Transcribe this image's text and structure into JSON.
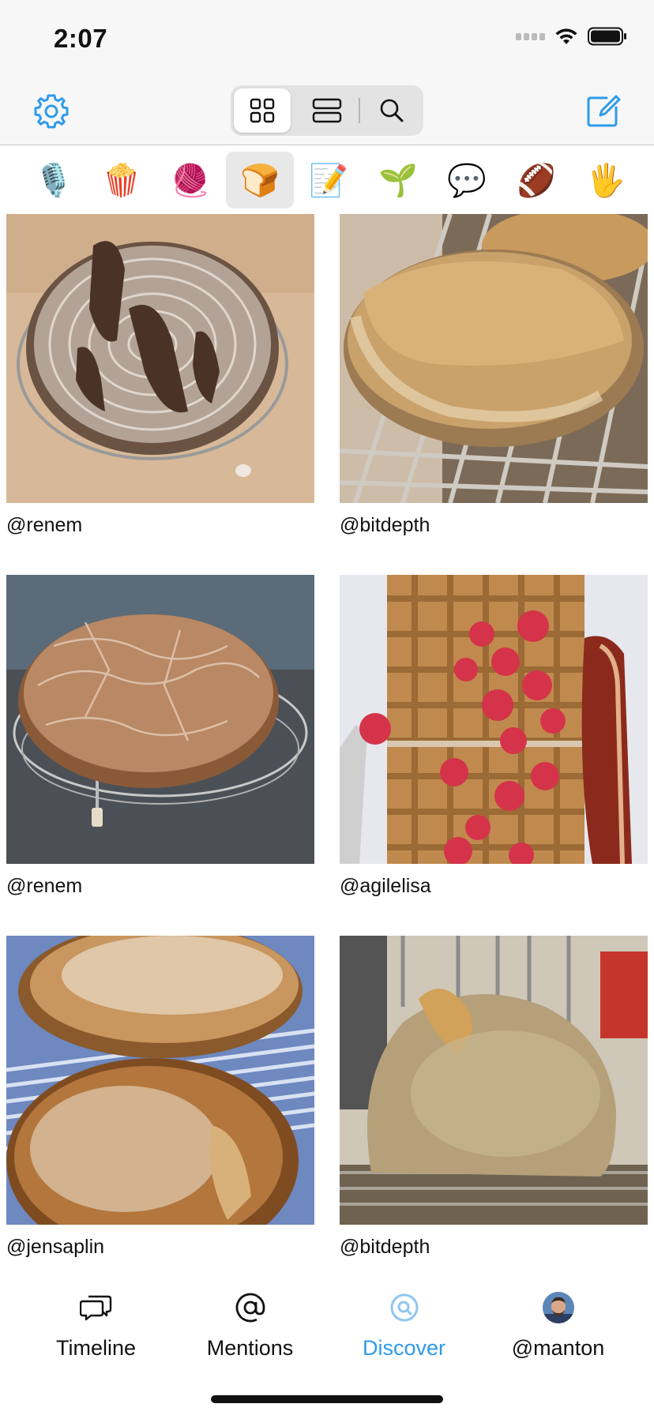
{
  "status_bar": {
    "time": "2:07"
  },
  "toolbar": {
    "view_modes": [
      "grid-view",
      "list-view",
      "search"
    ],
    "active_mode": "grid-view",
    "accent_color": "#2e9bea"
  },
  "categories": [
    {
      "emoji": "🎙️",
      "name": "podcasts"
    },
    {
      "emoji": "🍿",
      "name": "movies"
    },
    {
      "emoji": "🧶",
      "name": "knitting"
    },
    {
      "emoji": "🍞",
      "name": "bread",
      "active": true
    },
    {
      "emoji": "📝",
      "name": "writing"
    },
    {
      "emoji": "🌱",
      "name": "gardening"
    },
    {
      "emoji": "💬",
      "name": "conversation"
    },
    {
      "emoji": "🏈",
      "name": "football"
    },
    {
      "emoji": "🖐️",
      "name": "hello"
    }
  ],
  "posts": [
    {
      "username": "@renem"
    },
    {
      "username": "@bitdepth"
    },
    {
      "username": "@renem"
    },
    {
      "username": "@agilelisa"
    },
    {
      "username": "@jensaplin"
    },
    {
      "username": "@bitdepth"
    }
  ],
  "tabs": [
    {
      "label": "Timeline",
      "icon": "timeline-icon"
    },
    {
      "label": "Mentions",
      "icon": "at-icon"
    },
    {
      "label": "Discover",
      "icon": "discover-icon",
      "active": true
    },
    {
      "label": "@manton",
      "icon": "avatar"
    }
  ]
}
